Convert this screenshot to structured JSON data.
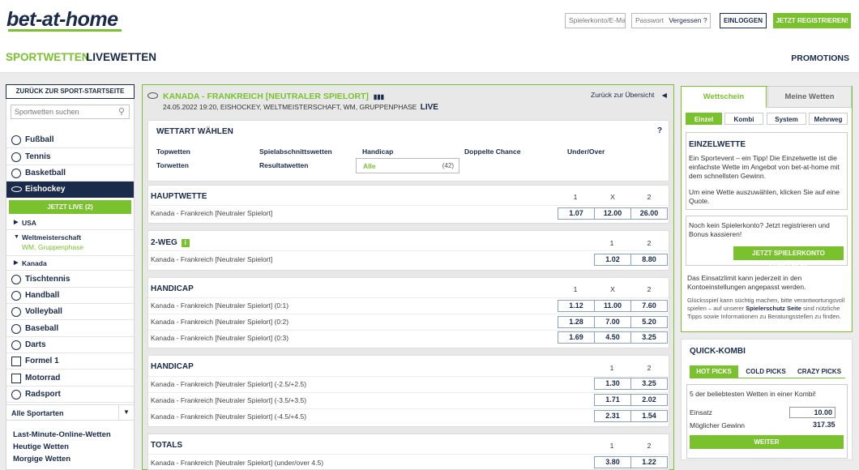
{
  "header": {
    "logo": "bet-at-home",
    "account_placeholder": "Spielerkonto/E-Mail",
    "password_placeholder": "Passwort",
    "forgot": "Vergessen ?",
    "login": "EINLOGGEN",
    "register": "JETZT REGISTRIEREN!",
    "nav": [
      "SPORTWETTEN",
      "LIVEWETTEN"
    ],
    "promotions": "PROMOTIONS"
  },
  "sidebar": {
    "back": "ZURÜCK ZUR SPORT-STARTSEITE",
    "search_placeholder": "Sportwetten suchen",
    "sports_top": [
      "Fußball",
      "Tennis",
      "Basketball"
    ],
    "active": "Eishockey",
    "live_button": "JETZT LIVE (2)",
    "sub_usa": "USA",
    "sub_wm": "Weltmeisterschaft",
    "sub_wm_detail": "WM, Gruppenphase",
    "sub_kanada": "Kanada",
    "sports_bottom": [
      "Tischtennis",
      "Handball",
      "Volleyball",
      "Baseball",
      "Darts",
      "Formel 1",
      "Motorrad",
      "Radsport"
    ],
    "all_sports": "Alle Sportarten",
    "links": [
      "Last-Minute-Online-Wetten",
      "Heutige Wetten",
      "Morgige Wetten"
    ]
  },
  "event": {
    "title": "KANADA - FRANKREICH [NEUTRALER SPIELORT]",
    "subtitle": "24.05.2022 19:20, EISHOCKEY, WELTMEISTERSCHAFT, WM, GRUPPENPHASE",
    "live": "LIVE",
    "back": "Zurück zur Übersicht"
  },
  "wettart": {
    "heading": "WETTART WÄHLEN",
    "help": "?",
    "row1": [
      "Topwetten",
      "Spielabschnittswetten",
      "Handicap",
      "Doppelte Chance",
      "Under/Over"
    ],
    "row2": [
      "Torwetten",
      "Resultatwetten"
    ],
    "alle_label": "Alle",
    "alle_count": "(42)"
  },
  "markets": [
    {
      "title": "HAUPTWETTE",
      "cols": [
        "1",
        "X",
        "2"
      ],
      "rows": [
        {
          "label": "Kanada - Frankreich [Neutraler Spielort]",
          "odds": [
            "1.07",
            "12.00",
            "26.00"
          ]
        }
      ]
    },
    {
      "title": "2-WEG",
      "cols": [
        "1",
        "2"
      ],
      "rows": [
        {
          "label": "Kanada - Frankreich [Neutraler Spielort]",
          "odds": [
            "1.02",
            "8.80"
          ]
        }
      ]
    },
    {
      "title": "HANDICAP",
      "cols": [
        "1",
        "X",
        "2"
      ],
      "rows": [
        {
          "label": "Kanada - Frankreich [Neutraler Spielort] (0:1)",
          "odds": [
            "1.12",
            "11.00",
            "7.60"
          ]
        },
        {
          "label": "Kanada - Frankreich [Neutraler Spielort] (0:2)",
          "odds": [
            "1.28",
            "7.00",
            "5.20"
          ]
        },
        {
          "label": "Kanada - Frankreich [Neutraler Spielort] (0:3)",
          "odds": [
            "1.69",
            "4.50",
            "3.25"
          ]
        }
      ]
    },
    {
      "title": "HANDICAP",
      "cols": [
        "1",
        "2"
      ],
      "rows": [
        {
          "label": "Kanada - Frankreich [Neutraler Spielort] (-2.5/+2.5)",
          "odds": [
            "1.30",
            "3.25"
          ]
        },
        {
          "label": "Kanada - Frankreich [Neutraler Spielort] (-3.5/+3.5)",
          "odds": [
            "1.71",
            "2.02"
          ]
        },
        {
          "label": "Kanada - Frankreich [Neutraler Spielort] (-4.5/+4.5)",
          "odds": [
            "2.31",
            "1.54"
          ]
        }
      ]
    },
    {
      "title": "TOTALS",
      "cols": [
        "1",
        "2"
      ],
      "rows": [
        {
          "label": "Kanada - Frankreich [Neutraler Spielort] (under/over 4.5)",
          "odds": [
            "3.80",
            "1.22"
          ]
        }
      ]
    }
  ],
  "betslip": {
    "tabs": [
      "Wettschein",
      "Meine Wetten"
    ],
    "subtabs": [
      "Einzel",
      "Kombi",
      "System",
      "Mehrweg"
    ],
    "heading": "EINZELWETTE",
    "text1": "Ein Sportevent – ein Tipp! Die Einzelwette ist die einfachste Wette im Angebot von bet-at-home mit dem schnellsten Gewinn.",
    "text2": "Um eine Wette auszuwählen, klicken Sie auf eine Quote.",
    "reg_text": "Noch kein Spielerkonto? Jetzt registrieren und Bonus kassieren!",
    "reg_button": "JETZT SPIELERKONTO ERÖFFNEN!",
    "limit_text": "Das Einsatzlimit kann jederzeit in den Kontoeinstellungen angepasst werden.",
    "gamble_pre": "Glücksspiel kann süchtig machen, bitte verantwortungsvoll spielen – auf unserer ",
    "gamble_link": "Spielerschutz Seite",
    "gamble_post": " sind nützliche Tipps sowie Informationen zu Beratungsstellen zu finden."
  },
  "quickkombi": {
    "title": "QUICK-KOMBI",
    "tabs": [
      "HOT PICKS",
      "COLD PICKS",
      "CRAZY PICKS"
    ],
    "text": "5 der beliebtesten Wetten in einer Kombi!",
    "einsatz_label": "Einsatz",
    "einsatz_value": "10.00",
    "gewinn_label": "Möglicher Gewinn",
    "gewinn_value": "317.35",
    "button": "WEITER"
  },
  "colors": {
    "accent": "#7ac12e",
    "navy": "#1a2a4a"
  }
}
